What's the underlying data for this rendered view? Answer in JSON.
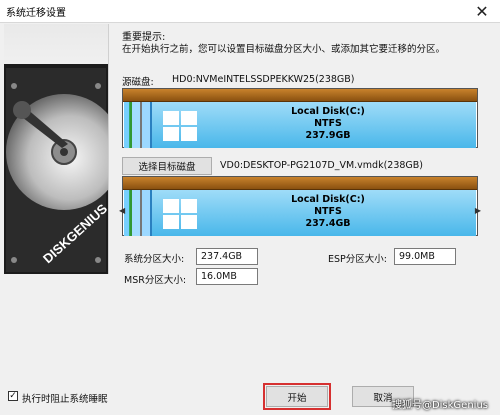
{
  "window": {
    "title": "系统迁移设置",
    "close_glyph": "✕"
  },
  "tips": {
    "heading": "重要提示:",
    "text": "在开始执行之前，您可以设置目标磁盘分区大小、或添加其它要迁移的分区。"
  },
  "source": {
    "label": "源磁盘:",
    "value": "HD0:NVMeINTELSSDPEKKW25(238GB)"
  },
  "source_disk": {
    "name": "Local Disk(C:)",
    "fs": "NTFS",
    "size": "237.9GB"
  },
  "target": {
    "button_label": "选择目标磁盘",
    "value": "VD0:DESKTOP-PG2107D_VM.vmdk(238GB)"
  },
  "target_disk": {
    "name": "Local Disk(C:)",
    "fs": "NTFS",
    "size": "237.4GB"
  },
  "fields": {
    "sys_label": "系统分区大小:",
    "sys_value": "237.4GB",
    "esp_label": "ESP分区大小:",
    "esp_value": "99.0MB",
    "msr_label": "MSR分区大小:",
    "msr_value": "16.0MB"
  },
  "footer": {
    "checkbox_label": "执行时阻止系统睡眠",
    "start_label": "开始",
    "cancel_label": "取消"
  },
  "watermark": "搜狐号@DiskGenius",
  "colors": {
    "disk_bar": "#c9822c",
    "partition": "#49b7ea",
    "highlight": "#d63030"
  }
}
